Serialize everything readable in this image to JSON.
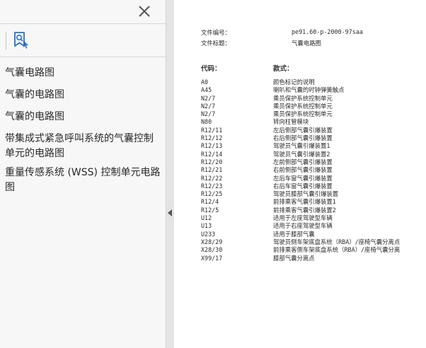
{
  "sidebar": {
    "outline": [
      {
        "label": "气囊电路图"
      },
      {
        "label": "气囊的电路图"
      },
      {
        "label": "气囊的电路图"
      },
      {
        "label": "带集成式紧急呼叫系统的气囊控制单元的电路图"
      },
      {
        "label": "重量传感系统 (WSS) 控制单元电路图"
      }
    ]
  },
  "document": {
    "file_number_label": "文件编号：",
    "file_number_value": "pe91.60-p-2000-97saa",
    "file_title_label": "文件标题：",
    "file_title_value": "气囊电路图",
    "code_header": "代码：",
    "desc_header": "款式：",
    "legend": [
      {
        "code": "A0",
        "desc": "颜色标记的说明"
      },
      {
        "code": "A45",
        "desc": "喇叭和气囊的时钟弹簧触点"
      },
      {
        "code": "N2/7",
        "desc": "乘员保护系统控制单元"
      },
      {
        "code": "N2/7",
        "desc": "乘员保护系统控制单元"
      },
      {
        "code": "N2/7",
        "desc": "乘员保护系统控制单元"
      },
      {
        "code": "N80",
        "desc": "转向柱管模块"
      },
      {
        "code": "R12/11",
        "desc": "左后侧部气囊引爆装置"
      },
      {
        "code": "R12/12",
        "desc": "右后侧部气囊引爆装置"
      },
      {
        "code": "R12/13",
        "desc": "驾驶员气囊引爆装置1"
      },
      {
        "code": "R12/14",
        "desc": "驾驶员气囊引爆装置2"
      },
      {
        "code": "R12/20",
        "desc": "左前侧部气囊引爆装置"
      },
      {
        "code": "R12/21",
        "desc": "右前侧部气囊引爆装置"
      },
      {
        "code": "R12/22",
        "desc": "左后车窗气囊引爆装置"
      },
      {
        "code": "R12/23",
        "desc": "右后车窗气囊引爆装置"
      },
      {
        "code": "R12/25",
        "desc": "驾驶员膝部气囊引爆装置"
      },
      {
        "code": "R12/4",
        "desc": "前排乘客气囊引爆装置1"
      },
      {
        "code": "R12/5",
        "desc": "前排乘客气囊引爆装置2"
      },
      {
        "code": "U12",
        "desc": "适用于左座驾驶型车辆"
      },
      {
        "code": "U13",
        "desc": "适用于右座驾驶型车辆"
      },
      {
        "code": "U233",
        "desc": "适用于膝部气囊"
      },
      {
        "code": "X28/29",
        "desc": "驾驶员侧车架底盘系统（RBA）/座椅气囊分离点"
      },
      {
        "code": "X28/30",
        "desc": "前排乘客侧车架底盘系统（RBA）/座椅气囊分离"
      },
      {
        "code": "X99/17",
        "desc": "膝部气囊分离点"
      }
    ]
  },
  "colors": {
    "sidebar_bg": "#f7f7f7",
    "splitter_bg": "#e4e4e4",
    "bookmark_icon": "#2a6fd1",
    "text": "#2b2b2b"
  },
  "icons": {
    "close": "close-icon",
    "bookmark": "bookmark-search-icon",
    "collapse": "collapse-left-icon"
  }
}
